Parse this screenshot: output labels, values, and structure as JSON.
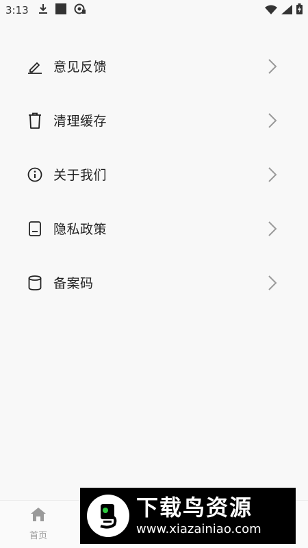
{
  "status_bar": {
    "time": "3:13",
    "icons": [
      "download-icon",
      "square-app-icon",
      "sync-app-icon",
      "wifi-icon",
      "cell-signal-icon",
      "battery-icon"
    ]
  },
  "menu": {
    "items": [
      {
        "label": "意见反馈",
        "icon": "pen-edit-icon"
      },
      {
        "label": "清理缓存",
        "icon": "trash-icon"
      },
      {
        "label": "关于我们",
        "icon": "info-icon"
      },
      {
        "label": "隐私政策",
        "icon": "document-icon"
      },
      {
        "label": "备案码",
        "icon": "database-icon"
      }
    ]
  },
  "bottom_nav": {
    "items": [
      {
        "label": "首页",
        "icon": "home-icon"
      }
    ]
  },
  "watermark": {
    "title": "下载鸟资源",
    "url": "www.xiazainiao.com"
  },
  "colors": {
    "background": "#f8f8f8",
    "text": "#222222",
    "chevron": "#9a9a9a",
    "nav_inactive": "#9a9a9a",
    "watermark_bg": "#000000",
    "logo_green": "#2ecc40"
  }
}
